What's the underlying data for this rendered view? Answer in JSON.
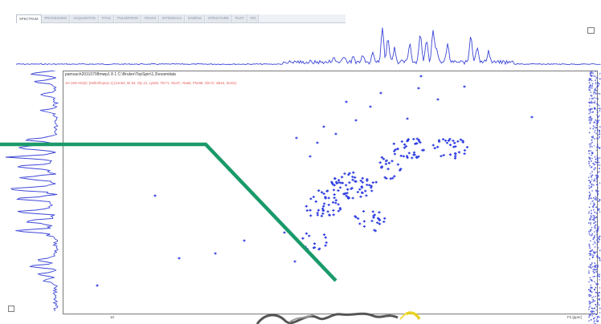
{
  "tabs": [
    {
      "label": "SPECTRUM",
      "active": true
    },
    {
      "label": "PROCESSING"
    },
    {
      "label": "ACQUISITION"
    },
    {
      "label": "TITLE"
    },
    {
      "label": "PULSEPROG"
    },
    {
      "label": "PEAKS"
    },
    {
      "label": "INTEGRALS"
    },
    {
      "label": "SAMPLE"
    },
    {
      "label": "STRUCTURE"
    },
    {
      "label": "PLOT"
    },
    {
      "label": "FID"
    }
  ],
  "plot": {
    "header": "pamuuch20110708mwp1  8  1  C:\\Bruker\\TopSpin\\1.3\\examdata",
    "subheader": "1H-15N HSQC  [Hellrefinprcp 1]  (Asn64, Ile 64, Gly 21, Lys56, Thr71, Glu37, Ala55, Phe88, Gln72, Val16, Ser61)",
    "x_axis_label": "F2 [ppm]",
    "x_tick": "10"
  },
  "colors": {
    "peak": "#2f3fe0",
    "overlay_line": "#1a9a6a",
    "projection": "#3b46d6",
    "subheader": "#e45b5b"
  }
}
